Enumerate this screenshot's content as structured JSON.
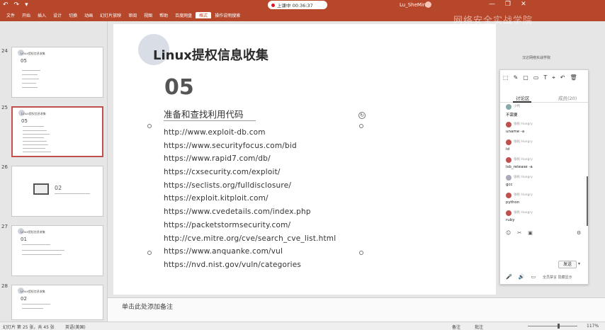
{
  "ribbon": {
    "qat": [
      "↶",
      "↷",
      "▾"
    ],
    "tabs": [
      "文件",
      "开始",
      "插入",
      "设计",
      "切换",
      "动画",
      "幻灯片放映",
      "审阅",
      "视图",
      "帮助",
      "百度网盘",
      "格式",
      "操作说明搜索"
    ],
    "selected_tab_index": 11,
    "recording_label": "上课中 00:36:37",
    "user_name": "Lu_SheMing",
    "window_controls": [
      "—",
      "❐",
      "✕"
    ],
    "watermark": "网络安全实战学院"
  },
  "thumbnails": [
    {
      "num": "24",
      "title": "Linux提权信息收集",
      "big": "05"
    },
    {
      "num": "25",
      "title": "Linux提权信息收集",
      "big": "05",
      "selected": true
    },
    {
      "num": "26",
      "title": "02",
      "big": ""
    },
    {
      "num": "27",
      "title": "Linux提权信息收集",
      "big": "01"
    },
    {
      "num": "28",
      "title": "Linux提权信息收集",
      "big": "02"
    }
  ],
  "slide": {
    "title": "Linux提权信息收集",
    "section_number": "05",
    "section_subtitle": "准备和查找利用代码",
    "urls": [
      "http://www.exploit-db.com",
      "https://www.securityfocus.com/bid",
      "https://www.rapid7.com/db/",
      "https://cxsecurity.com/exploit/",
      "https://seclists.org/fulldisclosure/",
      "https://exploit.kitploit.com/",
      "https://www.cvedetails.com/index.php",
      "https://packetstormsecurity.com/",
      "http://cve.mitre.org/cve/search_cve_list.html",
      "https://www.anquanke.com/vul",
      "https://nvd.nist.gov/vuln/categories"
    ]
  },
  "notes_placeholder": "单击此处添加备注",
  "status": {
    "slide_info": "幻灯片 第 25 张，共 45 张",
    "language": "英语(美国)",
    "notes_label": "备注",
    "comments_label": "批注",
    "zoom": "117%"
  },
  "chat": {
    "logo": "汉达网络实战学院",
    "tools": [
      "⬚",
      "✎",
      "▢",
      "▭",
      "T",
      "⌖",
      "↶",
      "🗑"
    ],
    "tab_discuss": "讨论区",
    "tab_members": "成员(20)",
    "messages": [
      {
        "name": "小鸭",
        "text": "不需要"
      },
      {
        "name": "张帆 Hungry",
        "text": "uname -a"
      },
      {
        "name": "张帆 Hungry",
        "text": "id"
      },
      {
        "name": "张帆 Hungry",
        "text": "lsb_release -a"
      },
      {
        "name": "张帆 Hungry",
        "text": "gcc"
      },
      {
        "name": "张帆 Hungry",
        "text": "python"
      },
      {
        "name": "张帆 Hungry",
        "text": "ruby"
      }
    ],
    "bottom_icons": [
      "☺",
      "✂",
      "▣"
    ],
    "settings_icon": "⚙",
    "send_label": "发送",
    "footer_icons": [
      "🎤",
      "🔊",
      "▭"
    ],
    "footer_label": "全员禁言 隐藏显示"
  }
}
